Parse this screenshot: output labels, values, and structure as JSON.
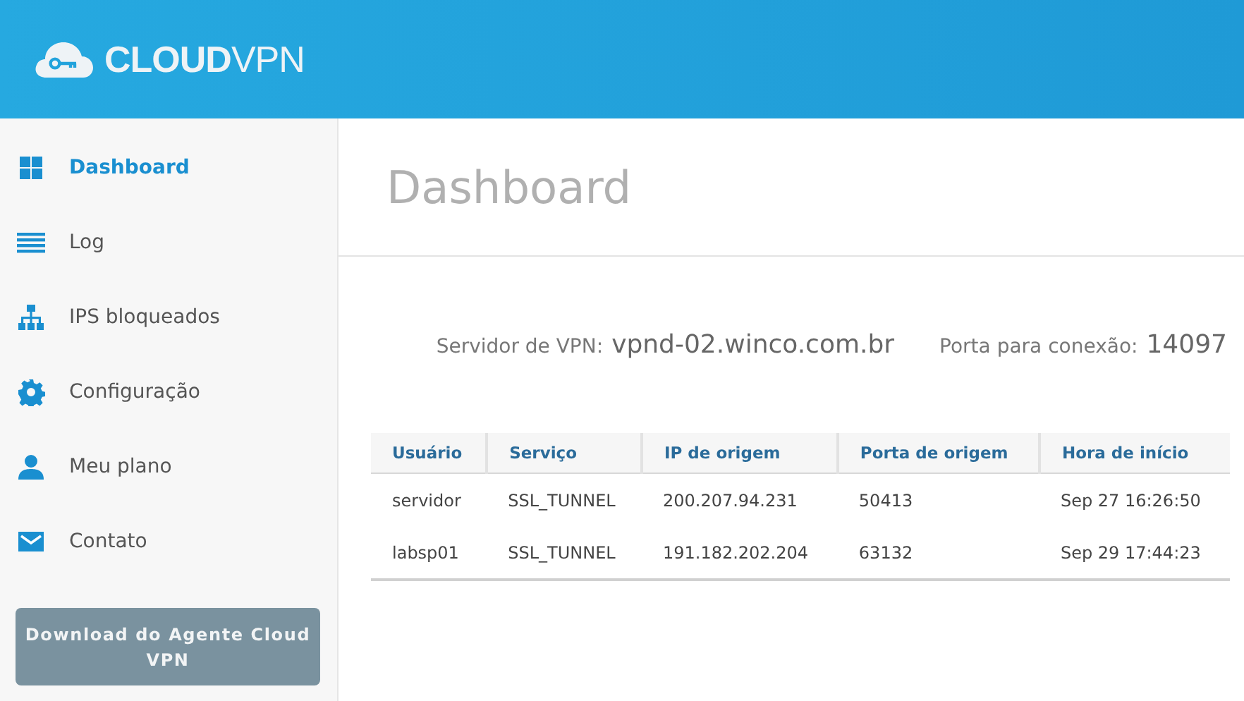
{
  "header": {
    "logo": "**CLOUD**VPN"
  },
  "sidebar": {
    "items": [
      {
        "label": "Dashboard",
        "kind": "grid",
        "selected": true
      },
      {
        "label": "Log",
        "kind": "lines",
        "selected": false
      },
      {
        "label": "IPS bloqueados",
        "kind": "tree",
        "selected": false
      },
      {
        "label": "Configuração",
        "kind": "gear",
        "selected": false
      },
      {
        "label": "Meu plano",
        "kind": "user",
        "selected": false
      },
      {
        "label": "Contato",
        "kind": "mail",
        "selected": false
      }
    ],
    "download_button": "Download do Agente Cloud VPN"
  },
  "page": {
    "title": "Dashboard",
    "server": {
      "label": "Servidor de VPN:",
      "value": "vpnd-02.winco.com.br"
    },
    "port": {
      "label": "Porta para conexão:",
      "value": "14097"
    }
  },
  "table": {
    "columns": [
      "Usuário",
      "Serviço",
      "IP de origem",
      "Porta de origem",
      "Hora de início"
    ],
    "rows": [
      [
        "servidor",
        "SSL_TUNNEL",
        "200.207.94.231",
        "50413",
        "Sep 27 16:26:50"
      ],
      [
        "labsp01",
        "SSL_TUNNEL",
        "191.182.202.204",
        "63132",
        "Sep 29 17:44:23"
      ]
    ]
  }
}
